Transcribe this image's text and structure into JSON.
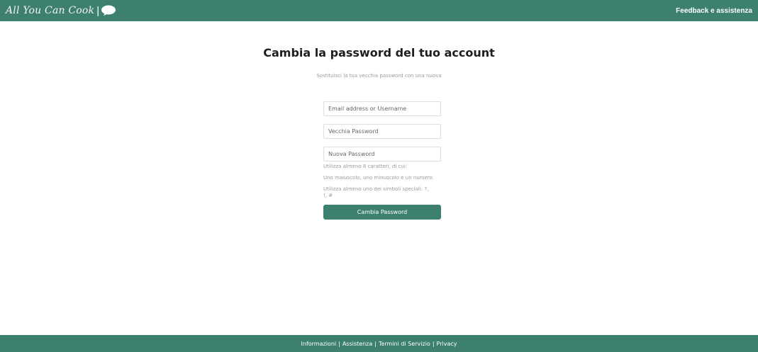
{
  "header": {
    "brand_text": "All You Can Cook",
    "brand_separator": "|",
    "brand_icon": "chat-bubble-icon",
    "feedback_link": "Feedback e assistenza"
  },
  "main": {
    "title": "Cambia la password del tuo account",
    "subtitle": "Sostituisci la tua vecchia password con una nuova",
    "form": {
      "identifier_placeholder": "Email address or Username",
      "old_password_placeholder": "Vecchia Password",
      "new_password_placeholder": "Nuova Password",
      "hints": [
        "Utilizza almeno 8 caratteri, di cui:",
        "Uno maiuscolo, uno minuscolo e un numero.",
        "Utilizza almeno uno dei simboli speciali: ?, !, #"
      ],
      "submit_label": "Cambia Password"
    }
  },
  "footer": {
    "links": [
      "Informazioni",
      "Assistenza",
      "Termini di Servizio",
      "Privacy"
    ],
    "separator": "|"
  },
  "colors": {
    "brand": "#3d8070",
    "text_dark": "#1e1e1e",
    "text_muted": "#9a9a9a"
  }
}
